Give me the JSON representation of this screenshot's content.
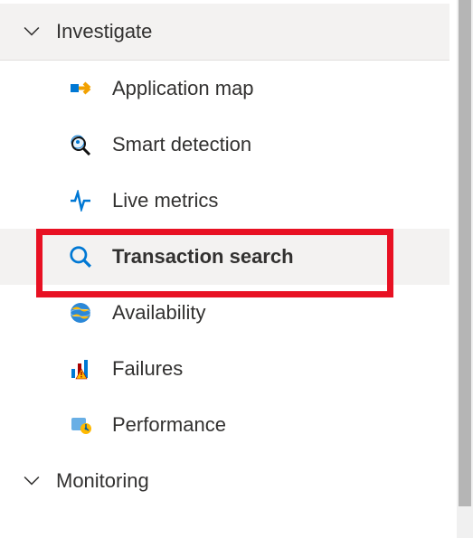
{
  "sections": [
    {
      "label": "Investigate",
      "items": [
        {
          "label": "Application map"
        },
        {
          "label": "Smart detection"
        },
        {
          "label": "Live metrics"
        },
        {
          "label": "Transaction search"
        },
        {
          "label": "Availability"
        },
        {
          "label": "Failures"
        },
        {
          "label": "Performance"
        }
      ]
    },
    {
      "label": "Monitoring",
      "items": []
    }
  ]
}
